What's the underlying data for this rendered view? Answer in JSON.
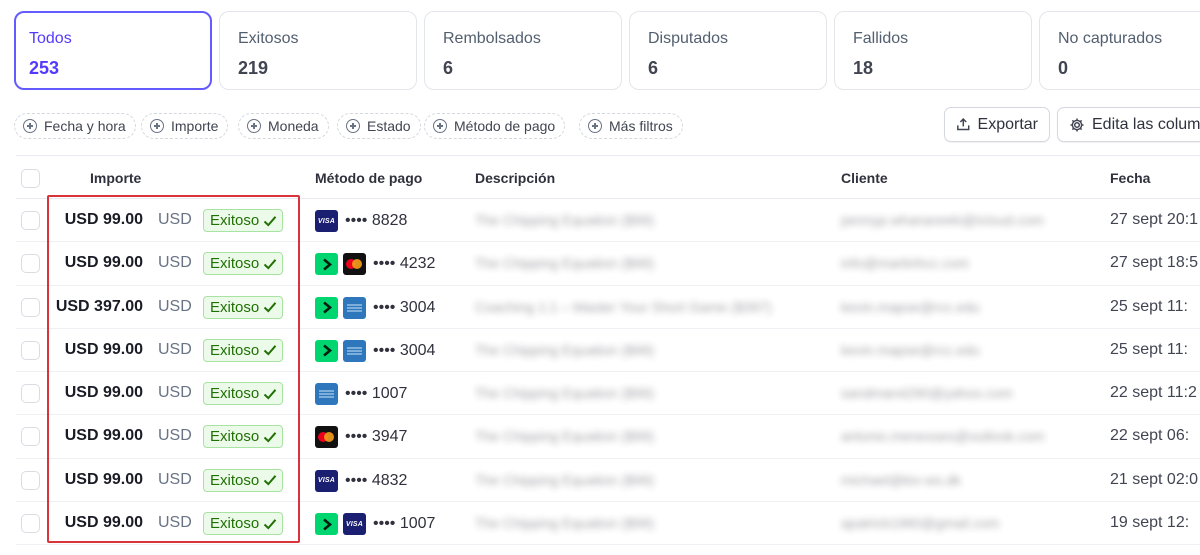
{
  "tabs": [
    {
      "label": "Todos",
      "count": "253"
    },
    {
      "label": "Exitosos",
      "count": "219"
    },
    {
      "label": "Rembolsados",
      "count": "6"
    },
    {
      "label": "Disputados",
      "count": "6"
    },
    {
      "label": "Fallidos",
      "count": "18"
    },
    {
      "label": "No capturados",
      "count": "0"
    }
  ],
  "filters": [
    {
      "label": "Fecha y hora"
    },
    {
      "label": "Importe"
    },
    {
      "label": "Moneda"
    },
    {
      "label": "Estado"
    },
    {
      "label": "Método de pago"
    },
    {
      "label": "Más filtros"
    }
  ],
  "actions": {
    "export_label": "Exportar",
    "edit_columns_label": "Edita las colum"
  },
  "table": {
    "headers": {
      "amount": "Importe",
      "payment_method": "Método de pago",
      "description": "Descripción",
      "customer": "Cliente",
      "date": "Fecha"
    },
    "rows": [
      {
        "amount": "USD 99.00",
        "currency": "USD",
        "status": "Exitoso",
        "logos": [
          "visa"
        ],
        "card": "•••• 8828",
        "description": "The Chipping Equation ($99)",
        "customer": "pennyp.whanareeki@icloud.com",
        "date": "27 sept 20:1"
      },
      {
        "amount": "USD 99.00",
        "currency": "USD",
        "status": "Exitoso",
        "logos": [
          "link",
          "mastercard"
        ],
        "card": "•••• 4232",
        "description": "The Chipping Equation ($99)",
        "customer": "info@martinhcc.com",
        "date": "27 sept 18:5"
      },
      {
        "amount": "USD 397.00",
        "currency": "USD",
        "status": "Exitoso",
        "logos": [
          "link",
          "amex"
        ],
        "card": "•••• 3004",
        "description": "Coaching 1:1 – Master Your Short Game ($397)",
        "customer": "kevin.mapse@rcc.edu",
        "date": "25 sept 11:"
      },
      {
        "amount": "USD 99.00",
        "currency": "USD",
        "status": "Exitoso",
        "logos": [
          "link",
          "amex"
        ],
        "card": "•••• 3004",
        "description": "The Chipping Equation ($99)",
        "customer": "kevin.mapse@rcc.edu",
        "date": "25 sept 11:"
      },
      {
        "amount": "USD 99.00",
        "currency": "USD",
        "status": "Exitoso",
        "logos": [
          "amex"
        ],
        "card": "•••• 1007",
        "description": "The Chipping Equation ($99)",
        "customer": "sandman4290@yahoo.com",
        "date": "22 sept 11:2"
      },
      {
        "amount": "USD 99.00",
        "currency": "USD",
        "status": "Exitoso",
        "logos": [
          "mastercard"
        ],
        "card": "•••• 3947",
        "description": "The Chipping Equation ($99)",
        "customer": "antonio.menesses@outlook.com",
        "date": "22 sept 06:"
      },
      {
        "amount": "USD 99.00",
        "currency": "USD",
        "status": "Exitoso",
        "logos": [
          "visa"
        ],
        "card": "•••• 4832",
        "description": "The Chipping Equation ($99)",
        "customer": "michael@kiv-ws.dk",
        "date": "21 sept 02:0"
      },
      {
        "amount": "USD 99.00",
        "currency": "USD",
        "status": "Exitoso",
        "logos": [
          "link",
          "visa"
        ],
        "card": "•••• 1007",
        "description": "The Chipping Equation ($99)",
        "customer": "apatrick1960@gmail.com",
        "date": "19 sept 12:"
      }
    ]
  },
  "colors": {
    "accent": "#635bff",
    "success": "#217005",
    "highlight_border": "#d9343b"
  }
}
